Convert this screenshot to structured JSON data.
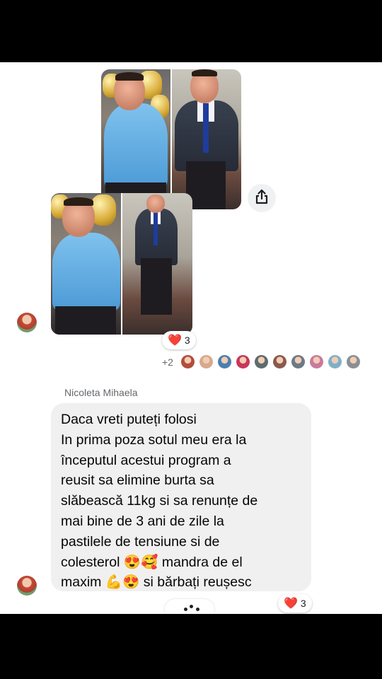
{
  "message_one": {
    "reaction": {
      "emoji": "❤️",
      "count": "3"
    },
    "seen_by": {
      "extra": "+2",
      "avatar_colors": [
        "#b44c3d",
        "#d7a98d",
        "#4c7fb1",
        "#c8385c",
        "#5e6b6d",
        "#8b5a4c",
        "#6e7a86",
        "#c97a9b",
        "#7fb0c9",
        "#8a8f94"
      ]
    }
  },
  "message_two": {
    "sender": "Nicoleta Mihaela",
    "lines": [
      "Daca vreti puteți folosi",
      "In prima poza sotul meu era la",
      "începutul acestui program a",
      "reusit sa elimine burta sa",
      "slăbească 11kg si sa renunțe de",
      "mai bine de 3 ani de zile la",
      "pastilele de tensiune si de",
      "colesterol 😍🥰 mandra de el",
      "maxim 💪😍 si bărbați reușesc"
    ],
    "reaction": {
      "emoji": "❤️",
      "count": "3"
    }
  },
  "icons": {
    "share": "share-icon",
    "typing": "typing-indicator-icon"
  }
}
